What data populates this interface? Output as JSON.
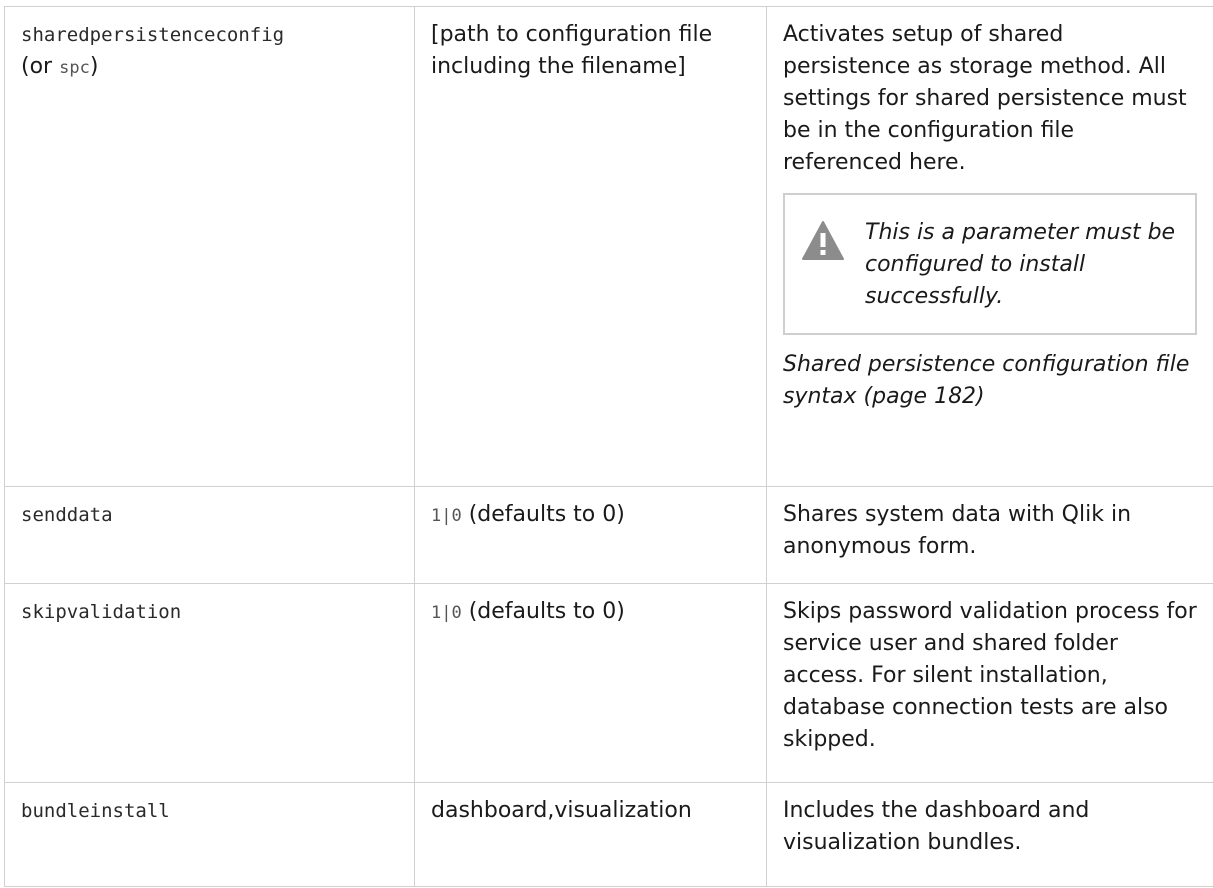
{
  "rows": [
    {
      "param": "sharedpersistenceconfig",
      "alias_open": "(or ",
      "alias_code": "spc",
      "alias_close": ")",
      "value": "[path to configuration file including the filename]",
      "description": "Activates setup of shared persistence as storage method. All settings for shared persistence must be in the configuration file referenced here.",
      "warning": {
        "icon": "warning-triangle-icon",
        "text": "This is a parameter must be configured to install successfully."
      },
      "link": "Shared persistence configuration file syntax (page 182)"
    },
    {
      "param": "senddata",
      "value_code": "1|0",
      "value_text": " (defaults to 0)",
      "description": "Shares system data with Qlik in anonymous form."
    },
    {
      "param": "skipvalidation",
      "value_code": "1|0",
      "value_text": " (defaults to 0)",
      "description": "Skips password validation process for service user and shared folder access. For silent installation, database connection tests are also skipped."
    },
    {
      "param": "bundleinstall",
      "value": "dashboard,visualization",
      "description": "Includes the dashboard and visualization bundles."
    }
  ],
  "colors": {
    "border": "#d0d0d0",
    "warning_icon": "#8c8c8c",
    "text": "#1a1a1a"
  }
}
